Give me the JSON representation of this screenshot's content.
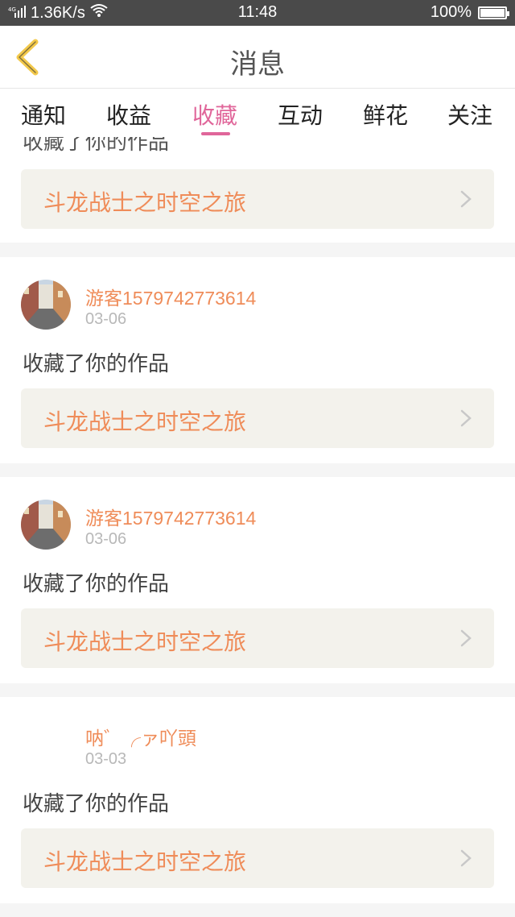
{
  "status_bar": {
    "network": "4G",
    "speed": "1.36K/s",
    "time": "11:48",
    "battery": "100%"
  },
  "header": {
    "back_icon": "chevron-left-icon",
    "title": "消息"
  },
  "tabs": [
    {
      "label": "通知"
    },
    {
      "label": "收益"
    },
    {
      "label": "收藏",
      "active": true
    },
    {
      "label": "互动"
    },
    {
      "label": "鲜花"
    },
    {
      "label": "关注"
    }
  ],
  "messages": [
    {
      "action": "收藏了你的作品",
      "work": "斗龙战士之时空之旅"
    },
    {
      "user": "游客1579742773614",
      "date": "03-06",
      "action": "收藏了你的作品",
      "work": "斗龙战士之时空之旅"
    },
    {
      "user": "游客1579742773614",
      "date": "03-06",
      "action": "收藏了你的作品",
      "work": "斗龙战士之时空之旅"
    },
    {
      "user": "呐゛╭ァ吖頭",
      "date": "03-03",
      "action": "收藏了你的作品",
      "work": "斗龙战士之时空之旅"
    }
  ],
  "colors": {
    "accent": "#e0669a",
    "orange": "#ef8c59",
    "back_icon": "#f3c94b"
  }
}
